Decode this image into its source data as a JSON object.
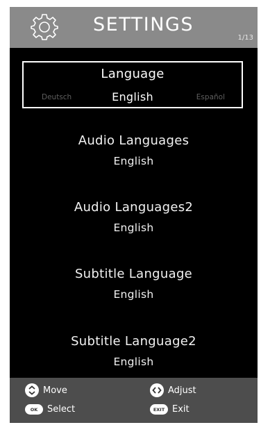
{
  "header": {
    "title": "SETTINGS",
    "page_count": "1/13",
    "icon": "gear-icon"
  },
  "selected": {
    "label": "Language",
    "value": "English",
    "prev_option": "Deutsch",
    "next_option": "Español"
  },
  "items": [
    {
      "label": "Audio Languages",
      "value": "English"
    },
    {
      "label": "Audio Languages2",
      "value": "English"
    },
    {
      "label": "Subtitle Language",
      "value": "English"
    },
    {
      "label": "Subtitle Language2",
      "value": "English"
    }
  ],
  "footer": {
    "move_label": "Move",
    "adjust_label": "Adjust",
    "select_label": "Select",
    "exit_label": "Exit",
    "ok_badge": "OK",
    "exit_badge": "EXIT"
  },
  "colors": {
    "header_bg": "#8a8a8a",
    "footer_bg": "#4d4d4d",
    "screen_bg": "#000000"
  }
}
